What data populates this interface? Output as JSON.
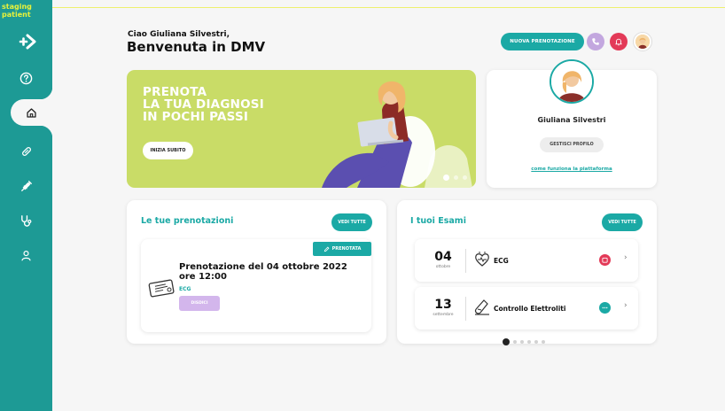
{
  "env": {
    "label_line1": "staging",
    "label_line2": "patient"
  },
  "sidebar": {
    "items": [
      {
        "name": "help",
        "icon": "help-circle-icon"
      },
      {
        "name": "home",
        "icon": "home-icon",
        "active": true
      },
      {
        "name": "drugs",
        "icon": "pill-icon"
      },
      {
        "name": "vaccines",
        "icon": "syringe-icon"
      },
      {
        "name": "visits",
        "icon": "stethoscope-icon"
      },
      {
        "name": "profile",
        "icon": "user-icon"
      }
    ]
  },
  "header": {
    "greeting": "Ciao Giuliana Silvestri,",
    "welcome": "Benvenuta in DMV",
    "new_booking_label": "NUOVA PRENOTAZIONE"
  },
  "banner": {
    "title": "PRENOTA\nLA TUA DIAGNOSI\nIN POCHI PASSI",
    "cta_label": "INIZIA SUBITO",
    "slides": 3,
    "active_slide": 1
  },
  "profile": {
    "name": "Giuliana Silvestri",
    "manage_label": "GESTISCI PROFILO",
    "how_link": "come funziona la piattaforma"
  },
  "bookings": {
    "title": "Le tue prenotazioni",
    "see_all": "VEDI TUTTE",
    "item": {
      "badge": "PRENOTATA",
      "title": "Prenotazione del 04 ottobre 2022 ore 12:00",
      "type": "ECG",
      "cancel_label": "DISDICI"
    }
  },
  "exams": {
    "title": "I tuoi Esami",
    "see_all": "VEDI TUTTE",
    "items": [
      {
        "day": "04",
        "month": "ottobre",
        "name": "ECG",
        "status_color": "#e33a58",
        "icon": "heart-icon"
      },
      {
        "day": "13",
        "month": "settembre",
        "name": "Controllo Elettroliti",
        "status_color": "#1ba9a5",
        "icon": "test-tube-icon"
      }
    ],
    "pages": 6,
    "active_page": 1
  },
  "colors": {
    "teal": "#1d9a95",
    "accent": "#1ba9a5",
    "lime": "#c9dc67",
    "pink": "#e33a58",
    "lilac": "#c3a7df"
  }
}
